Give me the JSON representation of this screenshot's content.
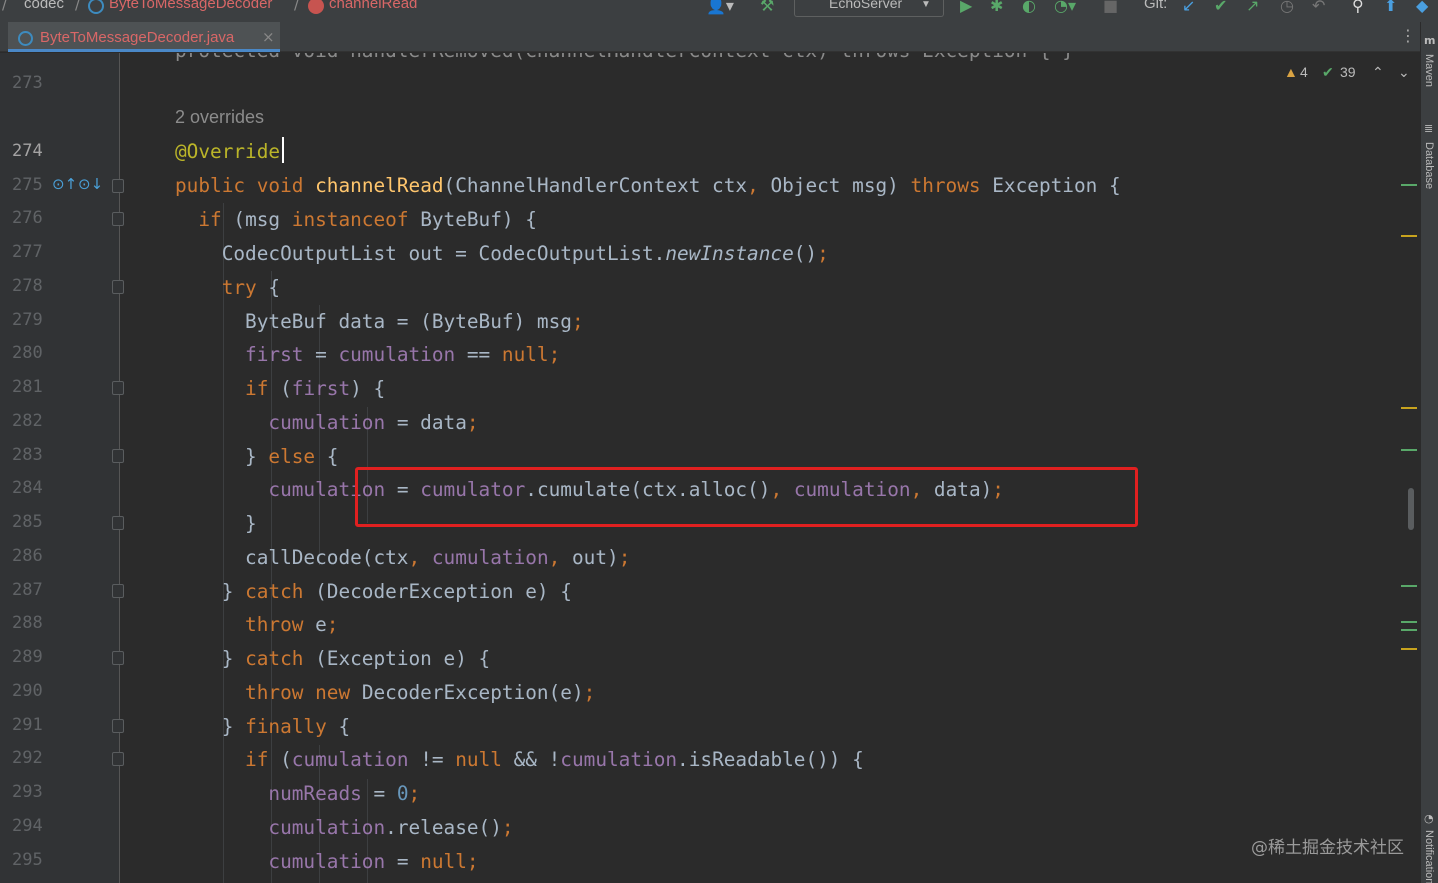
{
  "breadcrumbs": [
    {
      "label": "codec",
      "style": "plain"
    },
    {
      "label": "ByteToMessageDecoder",
      "style": "error",
      "icon": "class-icon"
    },
    {
      "label": "channelRead",
      "style": "error",
      "icon": "method-icon"
    }
  ],
  "toolbar": {
    "run_config": "EchoServer",
    "git_label": "Git:",
    "icons": [
      "user-icon",
      "build-hammer-icon",
      "run-icon",
      "debug-icon",
      "coverage-icon",
      "profile-icon",
      "stop-icon",
      "git-update-icon",
      "git-commit-icon",
      "git-push-icon",
      "history-icon",
      "rollback-icon",
      "search-icon",
      "update-icon"
    ]
  },
  "tab": {
    "label": "ByteToMessageDecoder.java",
    "color": "#d96767"
  },
  "inspections": {
    "warnings": "4",
    "ok": "39"
  },
  "hint": {
    "overrides": "2 overrides"
  },
  "partial_top_line": "protected void handlerRemoved(ChannelHandlerContext ctx) throws Exception { }",
  "line_numbers": [
    "273",
    "274",
    "275",
    "276",
    "277",
    "278",
    "279",
    "280",
    "281",
    "282",
    "283",
    "284",
    "285",
    "286",
    "287",
    "288",
    "289",
    "290",
    "291",
    "292",
    "293",
    "294",
    "295"
  ],
  "code": {
    "l274": "@Override",
    "l275": {
      "kw1": "public",
      "kw2": "void",
      "method": "channelRead",
      "params": "(ChannelHandlerContext ctx",
      "comma": ",",
      "params2": " Object msg) ",
      "throws": "throws",
      "rest": " Exception {"
    },
    "l276": {
      "kw": "if",
      "a": " (msg ",
      "inst": "instanceof",
      "b": " ByteBuf) {"
    },
    "l277": {
      "a": "CodecOutputList out = CodecOutputList.",
      "call": "newInstance",
      "b": "()",
      "semi": ";"
    },
    "l278": {
      "kw": "try",
      "b": " {"
    },
    "l279": {
      "a": "ByteBuf data = (ByteBuf) msg",
      "semi": ";"
    },
    "l280": {
      "f1": "first",
      "a": " = ",
      "f2": "cumulation",
      "b": " == ",
      "kw": "null",
      "semi": ";"
    },
    "l281": {
      "kw": "if",
      "a": " (",
      "f": "first",
      "b": ") {"
    },
    "l282": {
      "f": "cumulation",
      "a": " = data",
      "semi": ";"
    },
    "l283": {
      "a": "} ",
      "kw": "else",
      "b": " {"
    },
    "l284": {
      "f1": "cumulation",
      "a": " = ",
      "f2": "cumulator",
      "b": ".cumulate(ctx.alloc()",
      "c1": ",",
      "sp": " ",
      "f3": "cumulation",
      "c2": ",",
      "d": " data)",
      "semi": ";"
    },
    "l285": "}",
    "l286": {
      "a": "callDecode(ctx",
      "c1": ",",
      "sp": " ",
      "f": "cumulation",
      "c2": ",",
      "b": " out)",
      "semi": ";"
    },
    "l287": {
      "a": "} ",
      "kw": "catch",
      "b": " (DecoderException e) {"
    },
    "l288": {
      "kw": "throw",
      "a": " e",
      "semi": ";"
    },
    "l289": {
      "a": "} ",
      "kw": "catch",
      "b": " (Exception e) {"
    },
    "l290": {
      "kw1": "throw",
      "sp": " ",
      "kw2": "new",
      "a": " DecoderException(e)",
      "semi": ";"
    },
    "l291": {
      "a": "} ",
      "kw": "finally",
      "b": " {"
    },
    "l292": {
      "kw": "if",
      "a": " (",
      "f1": "cumulation",
      "b": " != ",
      "kw2": "null",
      "c": " && !",
      "f2": "cumulation",
      "d": ".isReadable()) {"
    },
    "l293": {
      "f": "numReads",
      "a": " = ",
      "n": "0",
      "semi": ";"
    },
    "l294": {
      "f": "cumulation",
      "a": ".release()",
      "semi": ";"
    },
    "l295": {
      "f": "cumulation",
      "a": " = ",
      "kw": "null",
      "semi": ";"
    }
  },
  "side_tools": [
    "Maven",
    "Database",
    "Notifications"
  ],
  "watermark": "@稀土掘金技术社区",
  "colors": {
    "keyword": "#cc7832",
    "method": "#ffc66d",
    "field": "#9876aa",
    "annotation": "#bbb529",
    "number": "#6897bb",
    "highlight_box": "#e02020"
  }
}
